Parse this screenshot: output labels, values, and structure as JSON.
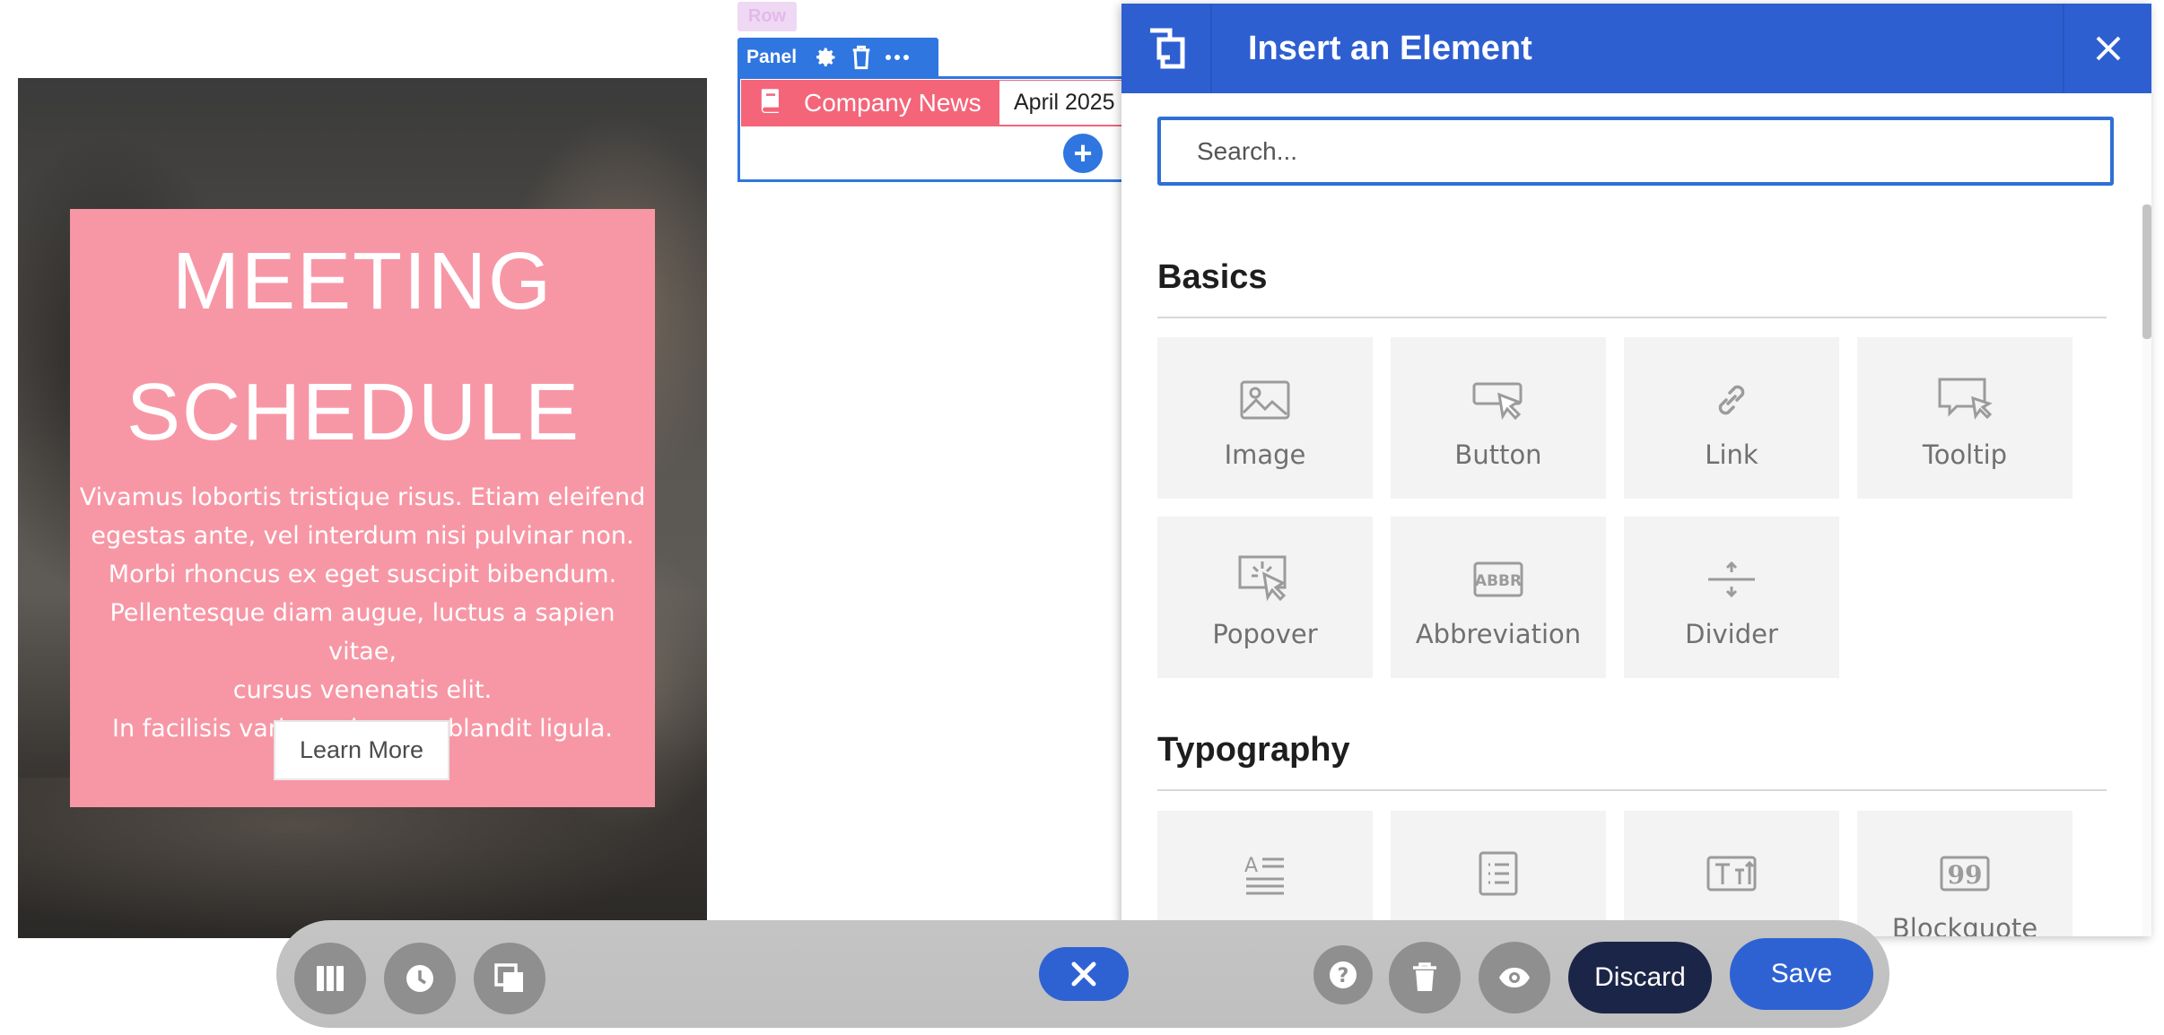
{
  "hero": {
    "title_line1": "MEETING",
    "title_line2": "SCHEDULE",
    "body_lines": [
      "Vivamus lobortis tristique risus. Etiam eleifend",
      "egestas ante, vel interdum nisi pulvinar non.",
      "Morbi rhoncus ex eget suscipit bibendum.",
      "Pellentesque diam augue, luctus a sapien vitae,",
      "cursus venenatis elit.",
      "In facilisis varius enim, nec blandit ligula."
    ],
    "button_label": "Learn More",
    "accent_color": "#f797a6"
  },
  "editor": {
    "row_label": "Row",
    "panel_label": "Panel",
    "panel_icons": [
      "gear-icon",
      "trash-icon",
      "more-dots-icon"
    ],
    "tab_active_label": "Company News",
    "tab_active_icon": "book-icon",
    "tab_next_label": "April 2025",
    "add_button_symbol": "+"
  },
  "dialog": {
    "title": "Insert an Element",
    "search_placeholder": "Search...",
    "sections": [
      {
        "title": "Basics",
        "items": [
          {
            "label": "Image",
            "icon": "image-icon"
          },
          {
            "label": "Button",
            "icon": "button-cursor-icon"
          },
          {
            "label": "Link",
            "icon": "link-icon"
          },
          {
            "label": "Tooltip",
            "icon": "tooltip-icon"
          },
          {
            "label": "Popover",
            "icon": "popover-icon"
          },
          {
            "label": "Abbreviation",
            "icon": "abbr-icon"
          },
          {
            "label": "Divider",
            "icon": "divider-icon"
          }
        ]
      },
      {
        "title": "Typography",
        "items": [
          {
            "label": "",
            "icon": "text-align-icon"
          },
          {
            "label": "",
            "icon": "list-doc-icon"
          },
          {
            "label": "",
            "icon": "text-size-icon"
          },
          {
            "label": "Blockquote",
            "icon": "blockquote-icon"
          }
        ]
      }
    ]
  },
  "toolbar": {
    "left_icons": [
      "columns-icon",
      "history-clock-icon",
      "layers-icon"
    ],
    "close_icon": "close-icon",
    "right_icons": [
      "help-icon",
      "trash-icon",
      "preview-eye-icon"
    ],
    "discard_label": "Discard",
    "save_label": "Save",
    "primary_color": "#2e62d3",
    "discard_color": "#1b2547"
  }
}
